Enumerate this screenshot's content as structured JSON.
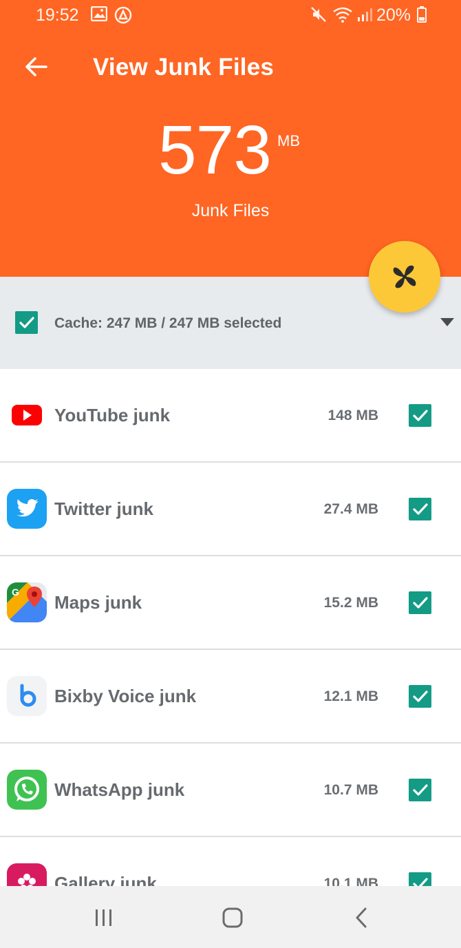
{
  "status_bar": {
    "time": "19:52",
    "battery": "20%",
    "icons": [
      "image-icon",
      "alert-icon",
      "mute-icon",
      "wifi-icon",
      "signal-icon",
      "battery-icon"
    ]
  },
  "header": {
    "title": "View Junk Files",
    "junk_amount": "573",
    "junk_unit": "MB",
    "junk_label": "Junk Files",
    "background_color": "#ff6523"
  },
  "fab": {
    "icon": "fan-icon",
    "color": "#fdc838"
  },
  "summary": {
    "text": "Cache: 247 MB / 247 MB selected",
    "checked": true
  },
  "items": [
    {
      "name": "YouTube junk",
      "size": "148 MB",
      "icon": "youtube-icon",
      "checked": true
    },
    {
      "name": "Twitter junk",
      "size": "27.4 MB",
      "icon": "twitter-icon",
      "checked": true
    },
    {
      "name": "Maps junk",
      "size": "15.2 MB",
      "icon": "maps-icon",
      "checked": true
    },
    {
      "name": "Bixby Voice junk",
      "size": "12.1 MB",
      "icon": "bixby-icon",
      "checked": true
    },
    {
      "name": "WhatsApp junk",
      "size": "10.7 MB",
      "icon": "whatsapp-icon",
      "checked": true
    },
    {
      "name": "Gallery junk",
      "size": "10.1 MB",
      "icon": "gallery-icon",
      "checked": true
    }
  ],
  "nav": [
    "recent-apps-icon",
    "home-icon",
    "back-icon"
  ],
  "colors": {
    "accent": "#ff6523",
    "checkbox": "#139b85",
    "fab": "#fdc838"
  }
}
